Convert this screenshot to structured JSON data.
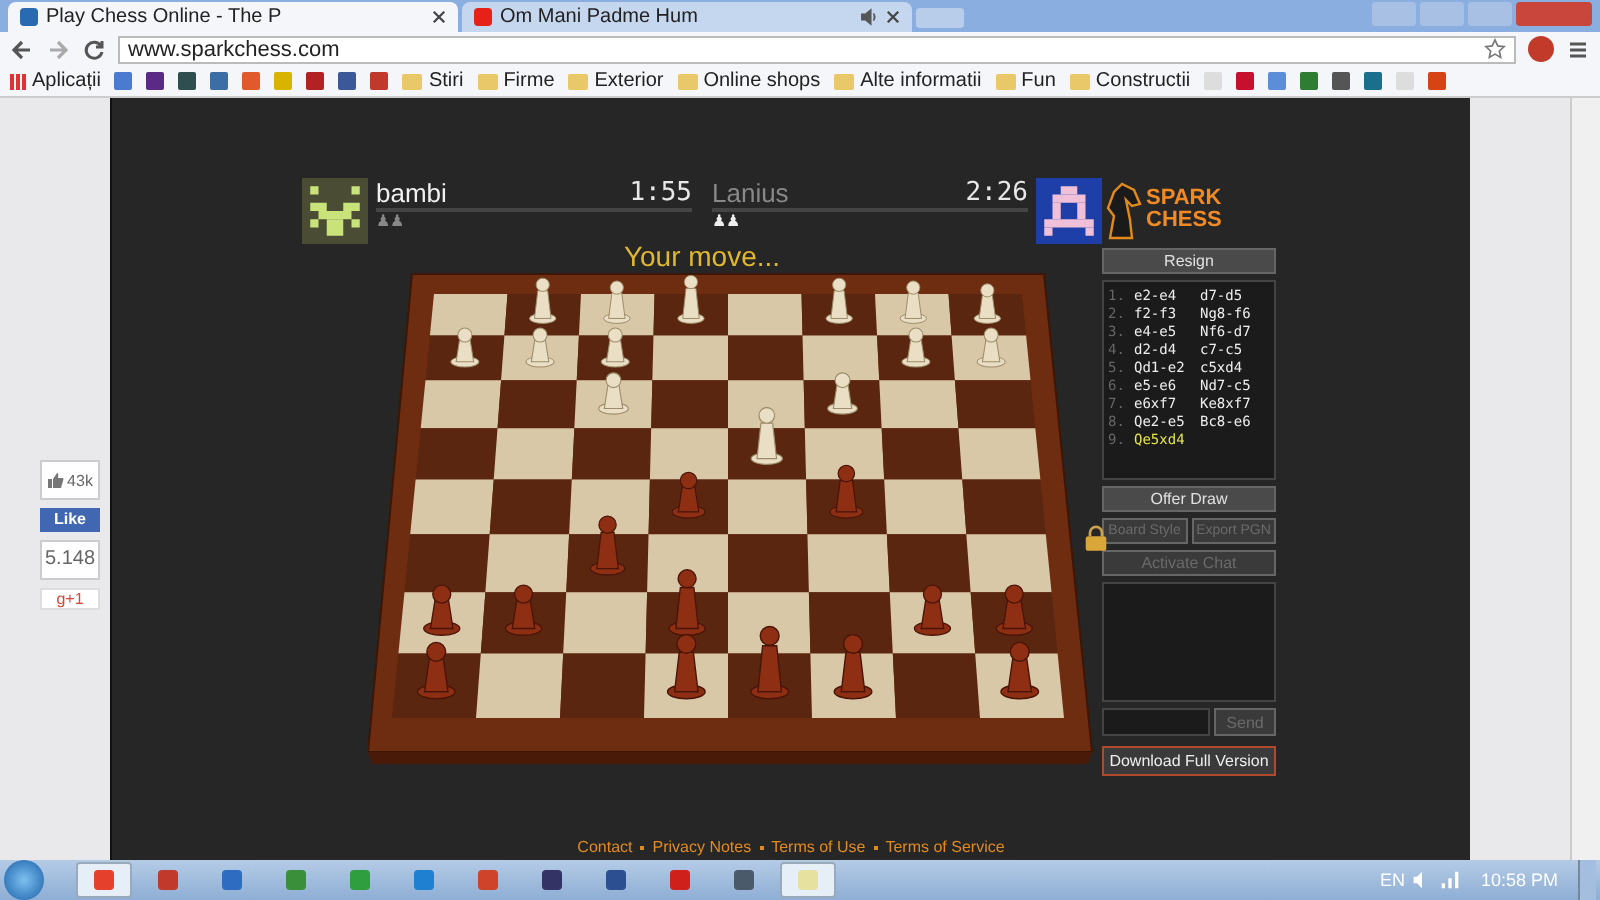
{
  "browser": {
    "tabs": [
      {
        "title": "Play Chess Online - The P",
        "selected": true,
        "audio": false
      },
      {
        "title": "Om Mani Padme Hum",
        "selected": false,
        "audio": true
      }
    ],
    "url": "www.sparkchess.com",
    "bookmarks": [
      {
        "kind": "apps",
        "label": "Aplicații"
      },
      {
        "kind": "icon",
        "color": "#4a7bd0"
      },
      {
        "kind": "icon",
        "color": "#5b2a86"
      },
      {
        "kind": "icon",
        "color": "#2f4f4f"
      },
      {
        "kind": "icon",
        "color": "#3b6ea5"
      },
      {
        "kind": "icon",
        "color": "#e05a2b"
      },
      {
        "kind": "icon",
        "color": "#d8b400"
      },
      {
        "kind": "icon",
        "color": "#b22222"
      },
      {
        "kind": "icon",
        "color": "#3b5998"
      },
      {
        "kind": "icon",
        "color": "#c0392b"
      },
      {
        "kind": "folder",
        "label": "Stiri"
      },
      {
        "kind": "folder",
        "label": "Firme"
      },
      {
        "kind": "folder",
        "label": "Exterior"
      },
      {
        "kind": "folder",
        "label": "Online shops"
      },
      {
        "kind": "folder",
        "label": "Alte informatii"
      },
      {
        "kind": "folder",
        "label": "Fun"
      },
      {
        "kind": "folder",
        "label": "Constructii"
      },
      {
        "kind": "icon",
        "color": "#dddddd"
      },
      {
        "kind": "icon",
        "color": "#c8102e"
      },
      {
        "kind": "icon",
        "color": "#5b8dd9"
      },
      {
        "kind": "icon",
        "color": "#2e7d32"
      },
      {
        "kind": "icon",
        "color": "#555555"
      },
      {
        "kind": "icon",
        "color": "#1a6f8c"
      },
      {
        "kind": "icon",
        "color": "#dddddd"
      },
      {
        "kind": "icon",
        "color": "#d84315"
      }
    ]
  },
  "game": {
    "players": [
      {
        "name": "bambi",
        "time": "1:55",
        "captured": "♟♟",
        "active": true
      },
      {
        "name": "Lanius",
        "time": "2:26",
        "captured": "♟♟",
        "active": false
      }
    ],
    "status": "Your move...",
    "logo_text": "SPARK CHESS",
    "resign": {
      "label": "Resign",
      "disabled": false
    },
    "moves": [
      {
        "number": "1.",
        "white": "e2-e4",
        "black": "d7-d5",
        "current": false
      },
      {
        "number": "2.",
        "white": "f2-f3",
        "black": "Ng8-f6",
        "current": false
      },
      {
        "number": "3.",
        "white": "e4-e5",
        "black": "Nf6-d7",
        "current": false
      },
      {
        "number": "4.",
        "white": "d2-d4",
        "black": "c7-c5",
        "current": false
      },
      {
        "number": "5.",
        "white": "Qd1-e2",
        "black": "c5xd4",
        "current": false
      },
      {
        "number": "6.",
        "white": "e5-e6",
        "black": "Nd7-c5",
        "current": false
      },
      {
        "number": "7.",
        "white": "e6xf7",
        "black": "Ke8xf7",
        "current": false
      },
      {
        "number": "8.",
        "white": "Qe2-e5",
        "black": "Bc8-e6",
        "current": false
      },
      {
        "number": "9.",
        "white": "Qe5xd4",
        "current": true
      }
    ],
    "offer_draw": {
      "label": "Offer Draw",
      "disabled": false
    },
    "board_style": {
      "label": "Board Style",
      "disabled": true,
      "locked": true
    },
    "export_pgn": {
      "label": "Export PGN",
      "disabled": true
    },
    "activate_chat": {
      "label": "Activate Chat",
      "disabled": true
    },
    "send": {
      "label": "Send",
      "disabled": true
    },
    "download": {
      "label": "Download Full Version"
    }
  },
  "social": {
    "likes": "43k",
    "like_button": "Like",
    "shares": "5.148",
    "gplus": "g+1"
  },
  "footer_links": [
    "Contact",
    "Privacy Notes",
    "Terms of Use",
    "Terms of Service"
  ],
  "taskbar": {
    "apps": [
      {
        "color": "#e5402b",
        "active": true
      },
      {
        "color": "#c0392b",
        "active": false
      },
      {
        "color": "#2d6cc0",
        "active": false
      },
      {
        "color": "#3a8f3a",
        "active": false
      },
      {
        "color": "#2e9e3e",
        "active": false
      },
      {
        "color": "#1f7fd1",
        "active": false
      },
      {
        "color": "#d0432b",
        "active": false
      },
      {
        "color": "#333366",
        "active": false
      },
      {
        "color": "#2b4f91",
        "active": false
      },
      {
        "color": "#d0201b",
        "active": false
      },
      {
        "color": "#4a5a6a",
        "active": false
      },
      {
        "color": "#e7e1a0",
        "active": true
      }
    ],
    "language": "EN",
    "time": "10:58 PM"
  }
}
